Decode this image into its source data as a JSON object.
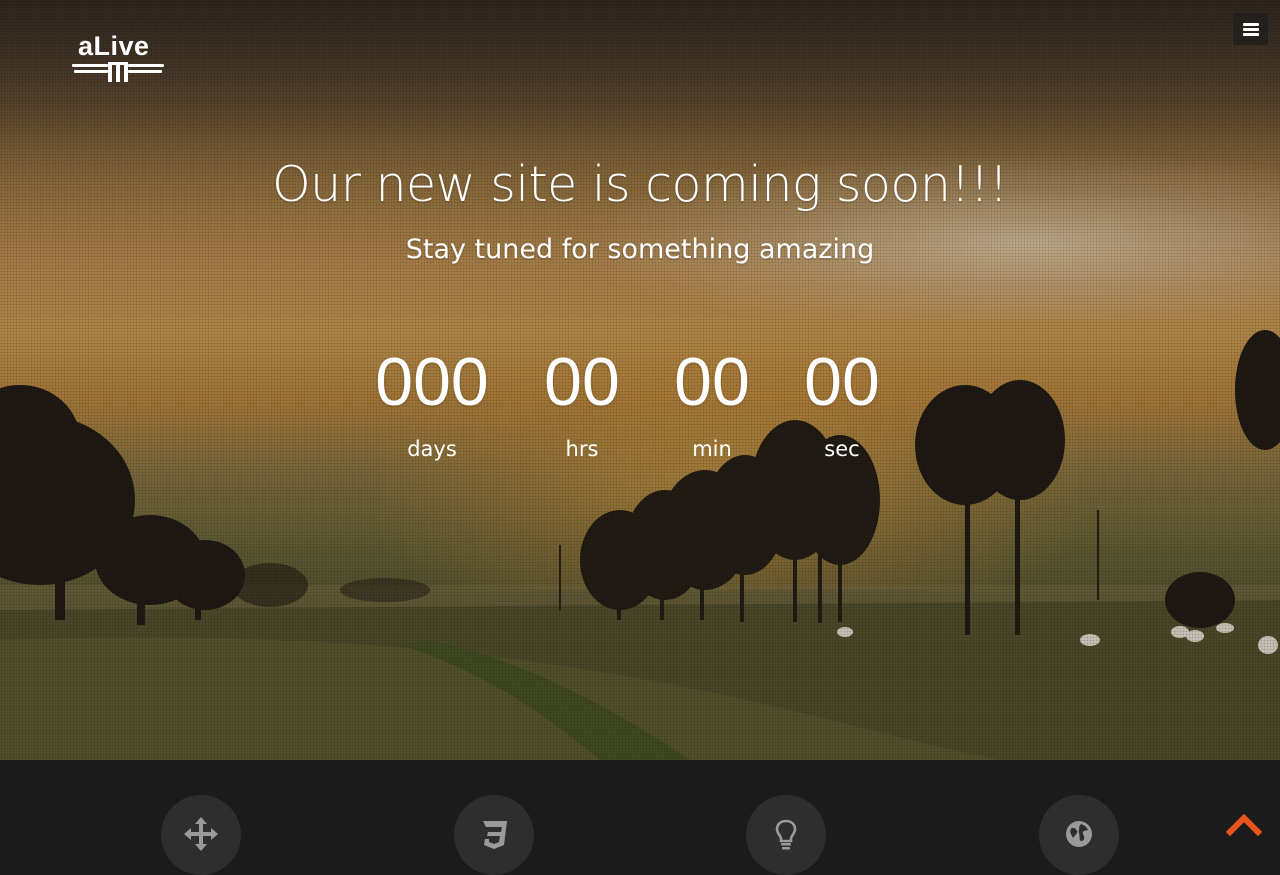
{
  "brand": {
    "logo_text": "aLive"
  },
  "header": {
    "menu_icon": "hamburger-menu-icon"
  },
  "hero": {
    "headline": "Our new site is coming soon!!!",
    "subheadline": "Stay tuned for something amazing"
  },
  "countdown": {
    "units": [
      {
        "value": "000",
        "label": "days"
      },
      {
        "value": "00",
        "label": "hrs"
      },
      {
        "value": "00",
        "label": "min"
      },
      {
        "value": "00",
        "label": "sec"
      }
    ]
  },
  "features": {
    "icons": [
      "move-arrows-icon",
      "css3-icon",
      "lightbulb-icon",
      "globe-icon"
    ]
  },
  "scroll_top": {
    "icon": "chevron-up-icon",
    "color": "#e8541c"
  },
  "colors": {
    "footer_bg": "#1b1b1b",
    "feature_circle": "#2e2e2e",
    "feature_icon": "#9a9a9a",
    "accent": "#e8541c"
  }
}
